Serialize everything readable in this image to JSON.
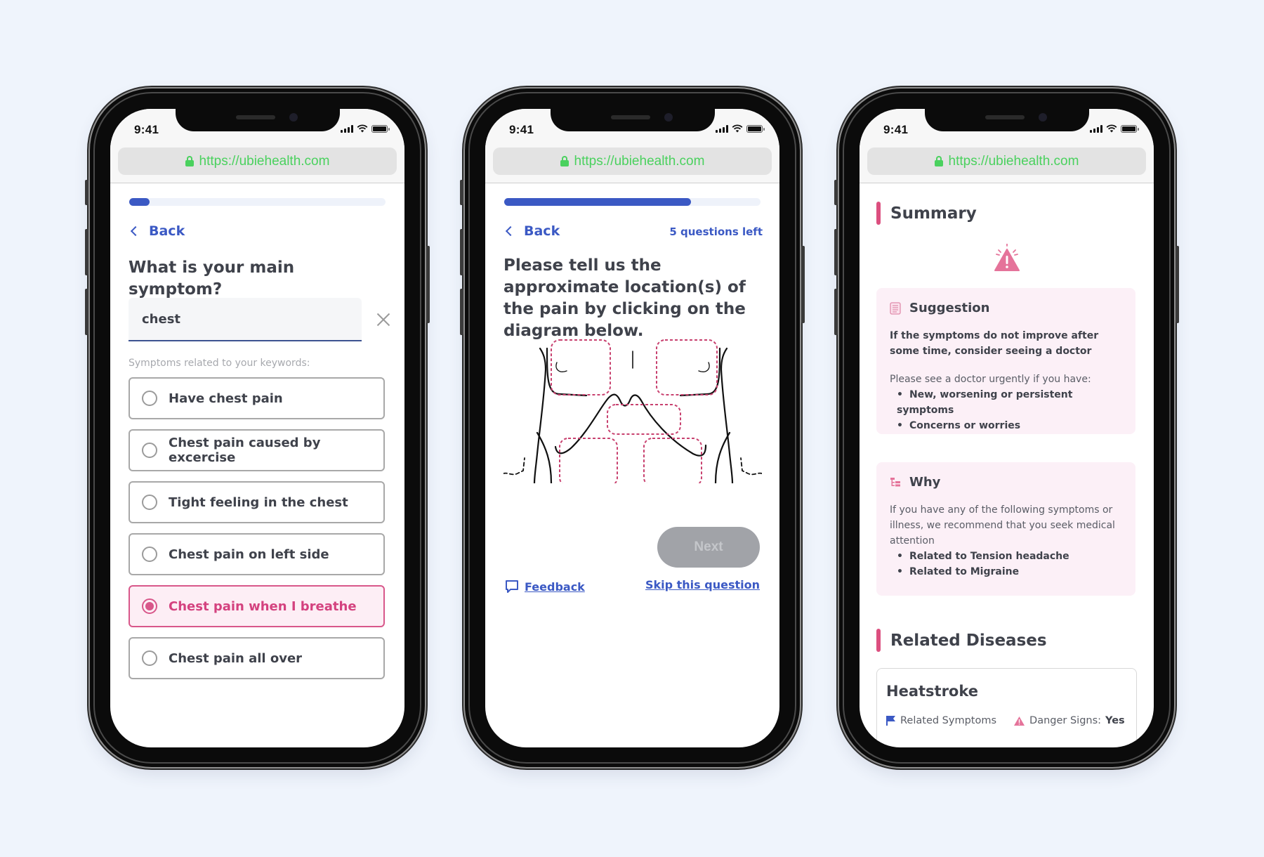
{
  "colors": {
    "background": "#eff4fc",
    "brand_blue": "#3b59c4",
    "accent_pink": "#d8578a",
    "url_green": "#4ad15e",
    "card_pink": "#fcf0f7",
    "disabled_gray": "#a1a3a8"
  },
  "phones": [
    {
      "status": {
        "time": "9:41"
      },
      "browser": {
        "url": "https://ubiehealth.com"
      },
      "progress": {
        "fraction": 0.08
      },
      "nav": {
        "back_label": "Back"
      },
      "question": "What is your main symptom?",
      "search": {
        "value": "chest",
        "clear_icon": "close-icon"
      },
      "hint": "Symptoms related to your keywords:",
      "options": [
        {
          "label": "Have chest pain",
          "selected": false
        },
        {
          "label": "Chest pain caused by excercise",
          "selected": false
        },
        {
          "label": "Tight feeling in the chest",
          "selected": false
        },
        {
          "label": "Chest pain on left side",
          "selected": false
        },
        {
          "label": "Chest pain when I breathe",
          "selected": true
        },
        {
          "label": "Chest pain all over",
          "selected": false
        }
      ]
    },
    {
      "status": {
        "time": "9:41"
      },
      "browser": {
        "url": "https://ubiehealth.com"
      },
      "progress": {
        "fraction": 0.73
      },
      "nav": {
        "back_label": "Back",
        "questions_left": "5 questions left"
      },
      "question": "Please tell us the approximate location(s) of the pain by clicking on the diagram below.",
      "diagram": {
        "regions": [
          "upper-right-chest",
          "upper-left-chest",
          "epigastric",
          "lower-right-abdomen",
          "lower-left-abdomen"
        ]
      },
      "next_label": "Next",
      "feedback_label": "Feedback",
      "skip_label": "Skip this question"
    },
    {
      "status": {
        "time": "9:41"
      },
      "browser": {
        "url": "https://ubiehealth.com"
      },
      "summary": {
        "title": "Summary",
        "suggestion": {
          "title": "Suggestion",
          "lead": "If the symptoms do not improve after some time, consider seeing a doctor",
          "urgent_intro": "Please see a doctor urgently if you have:",
          "bullets": [
            "New, worsening or persistent symptoms",
            "Concerns or worries"
          ]
        },
        "why": {
          "title": "Why",
          "text": "If you have any of the following symptoms or illness, we recommend that you seek medical attention",
          "bullets": [
            "Related to Tension headache",
            "Related to Migraine"
          ]
        }
      },
      "related": {
        "title": "Related Diseases",
        "diseases": [
          {
            "name": "Heatstroke",
            "related_label": "Related Symptoms",
            "danger_label": "Danger Signs:",
            "danger_value": "Yes"
          }
        ]
      }
    }
  ]
}
